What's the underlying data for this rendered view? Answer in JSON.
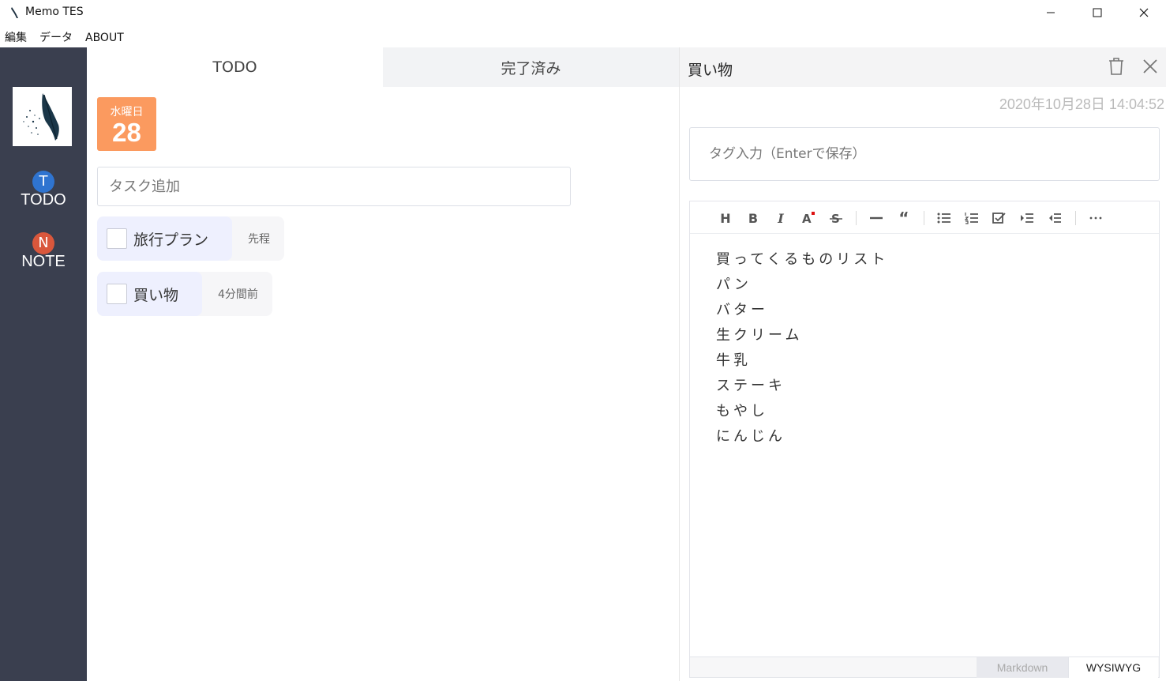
{
  "window": {
    "title": "Memo TES"
  },
  "menu": [
    "編集",
    "データ",
    "ABOUT"
  ],
  "sidebar": {
    "items": [
      {
        "badge": "T",
        "label": "TODO",
        "color": "#2f74d0"
      },
      {
        "badge": "N",
        "label": "NOTE",
        "color": "#d9573c"
      }
    ]
  },
  "tabs": {
    "todo": "TODO",
    "done": "完了済み"
  },
  "date": {
    "weekday": "水曜日",
    "day": "28"
  },
  "task_input": {
    "placeholder": "タスク追加"
  },
  "tasks": [
    {
      "label": "旅行プラン",
      "time": "先程"
    },
    {
      "label": "買い物",
      "time": "4分間前"
    }
  ],
  "note": {
    "title": "買い物",
    "datetime": "2020年10月28日 14:04:52",
    "tag_placeholder": "タグ入力（Enterで保存）",
    "lines": [
      "買ってくるものリスト",
      "パン",
      "バター",
      "生クリーム",
      "牛乳",
      "ステーキ",
      "もやし",
      "にんじん"
    ],
    "modes": {
      "markdown": "Markdown",
      "wysiwyg": "WYSIWYG"
    }
  },
  "toolbar_icons": [
    "heading-icon",
    "bold-icon",
    "italic-icon",
    "font-color-icon",
    "strikethrough-icon",
    "horizontal-rule-icon",
    "quote-icon",
    "bullet-list-icon",
    "ordered-list-icon",
    "check-list-icon",
    "indent-icon",
    "outdent-icon",
    "more-icon"
  ],
  "colors": {
    "sidebar": "#3a3f4f",
    "date_accent": "#fb9a5f",
    "task_bg": "#eef0fe"
  }
}
